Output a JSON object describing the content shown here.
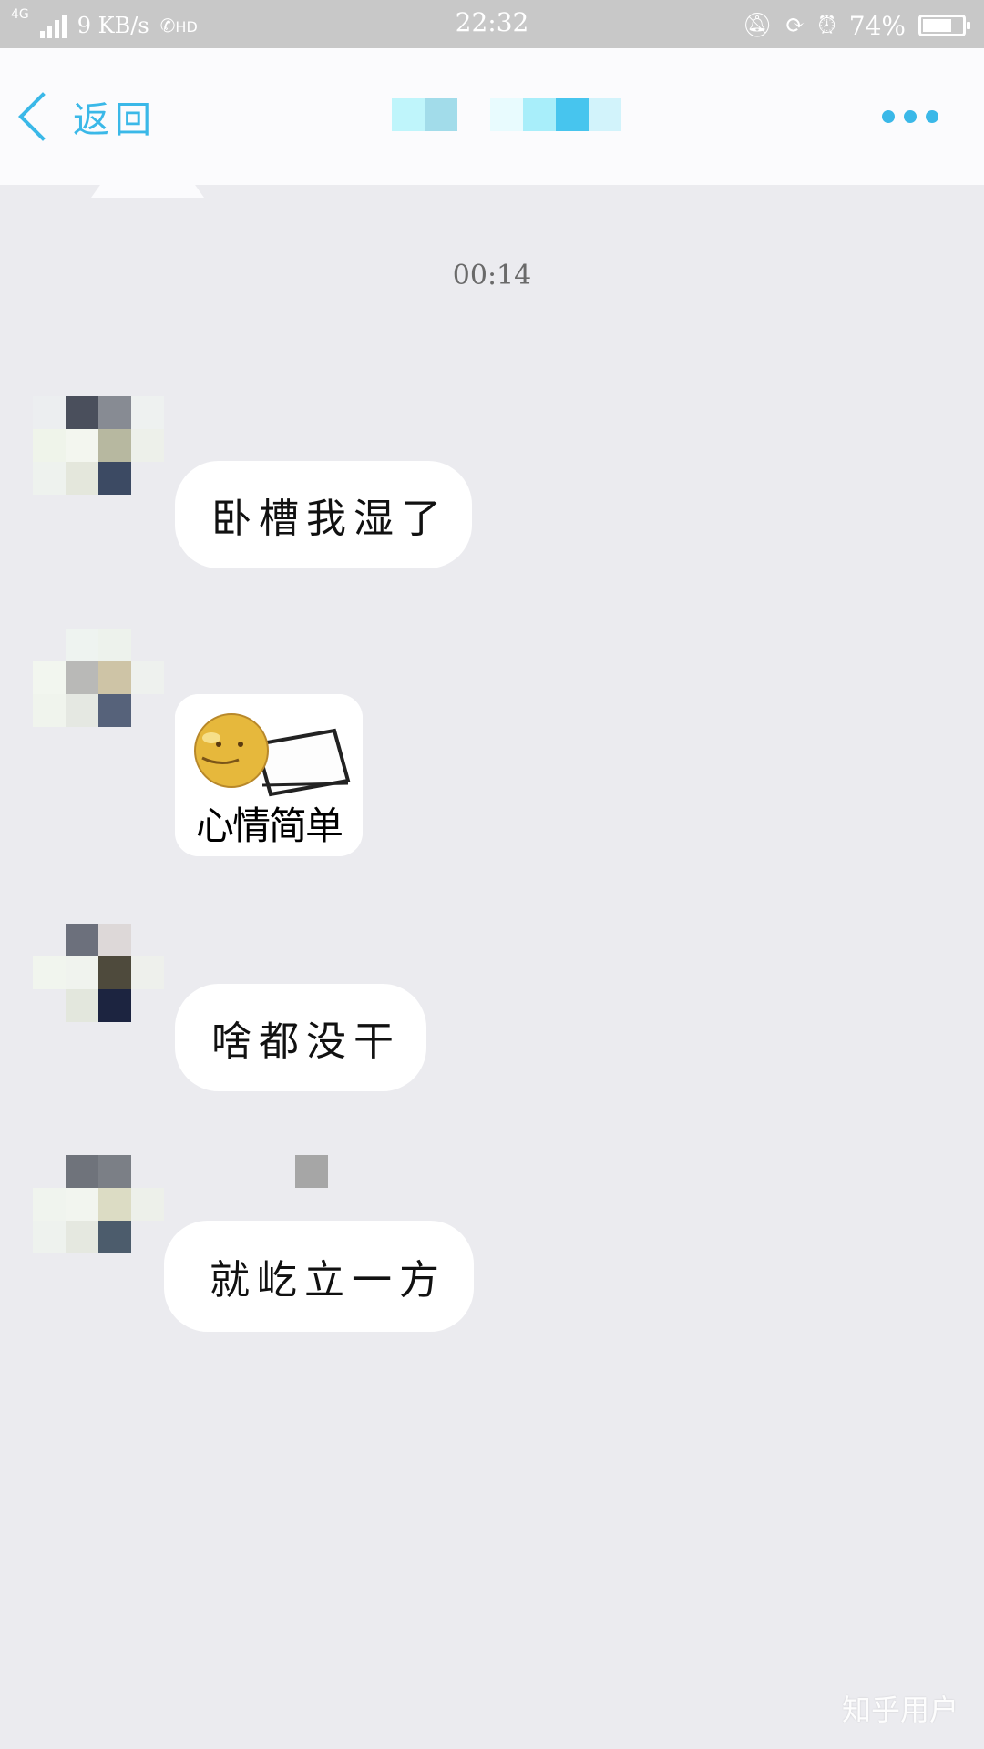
{
  "status_bar": {
    "network": "4G",
    "speed": "9 KB/s",
    "call_badge": "HD",
    "time": "22:32",
    "battery": "74%",
    "battery_level": 0.74
  },
  "header": {
    "back_label": "返回",
    "menu_icon": "more-dots-icon",
    "accent_color": "#3ab8e8"
  },
  "chat": {
    "timestamp": "00:14",
    "messages": [
      {
        "type": "text",
        "text": "卧槽我湿了"
      },
      {
        "type": "sticker",
        "caption": "心情简单"
      },
      {
        "type": "text",
        "text": "啥都没干"
      },
      {
        "type": "text",
        "text": "就屹立一方"
      }
    ]
  },
  "watermark": "知乎用户"
}
